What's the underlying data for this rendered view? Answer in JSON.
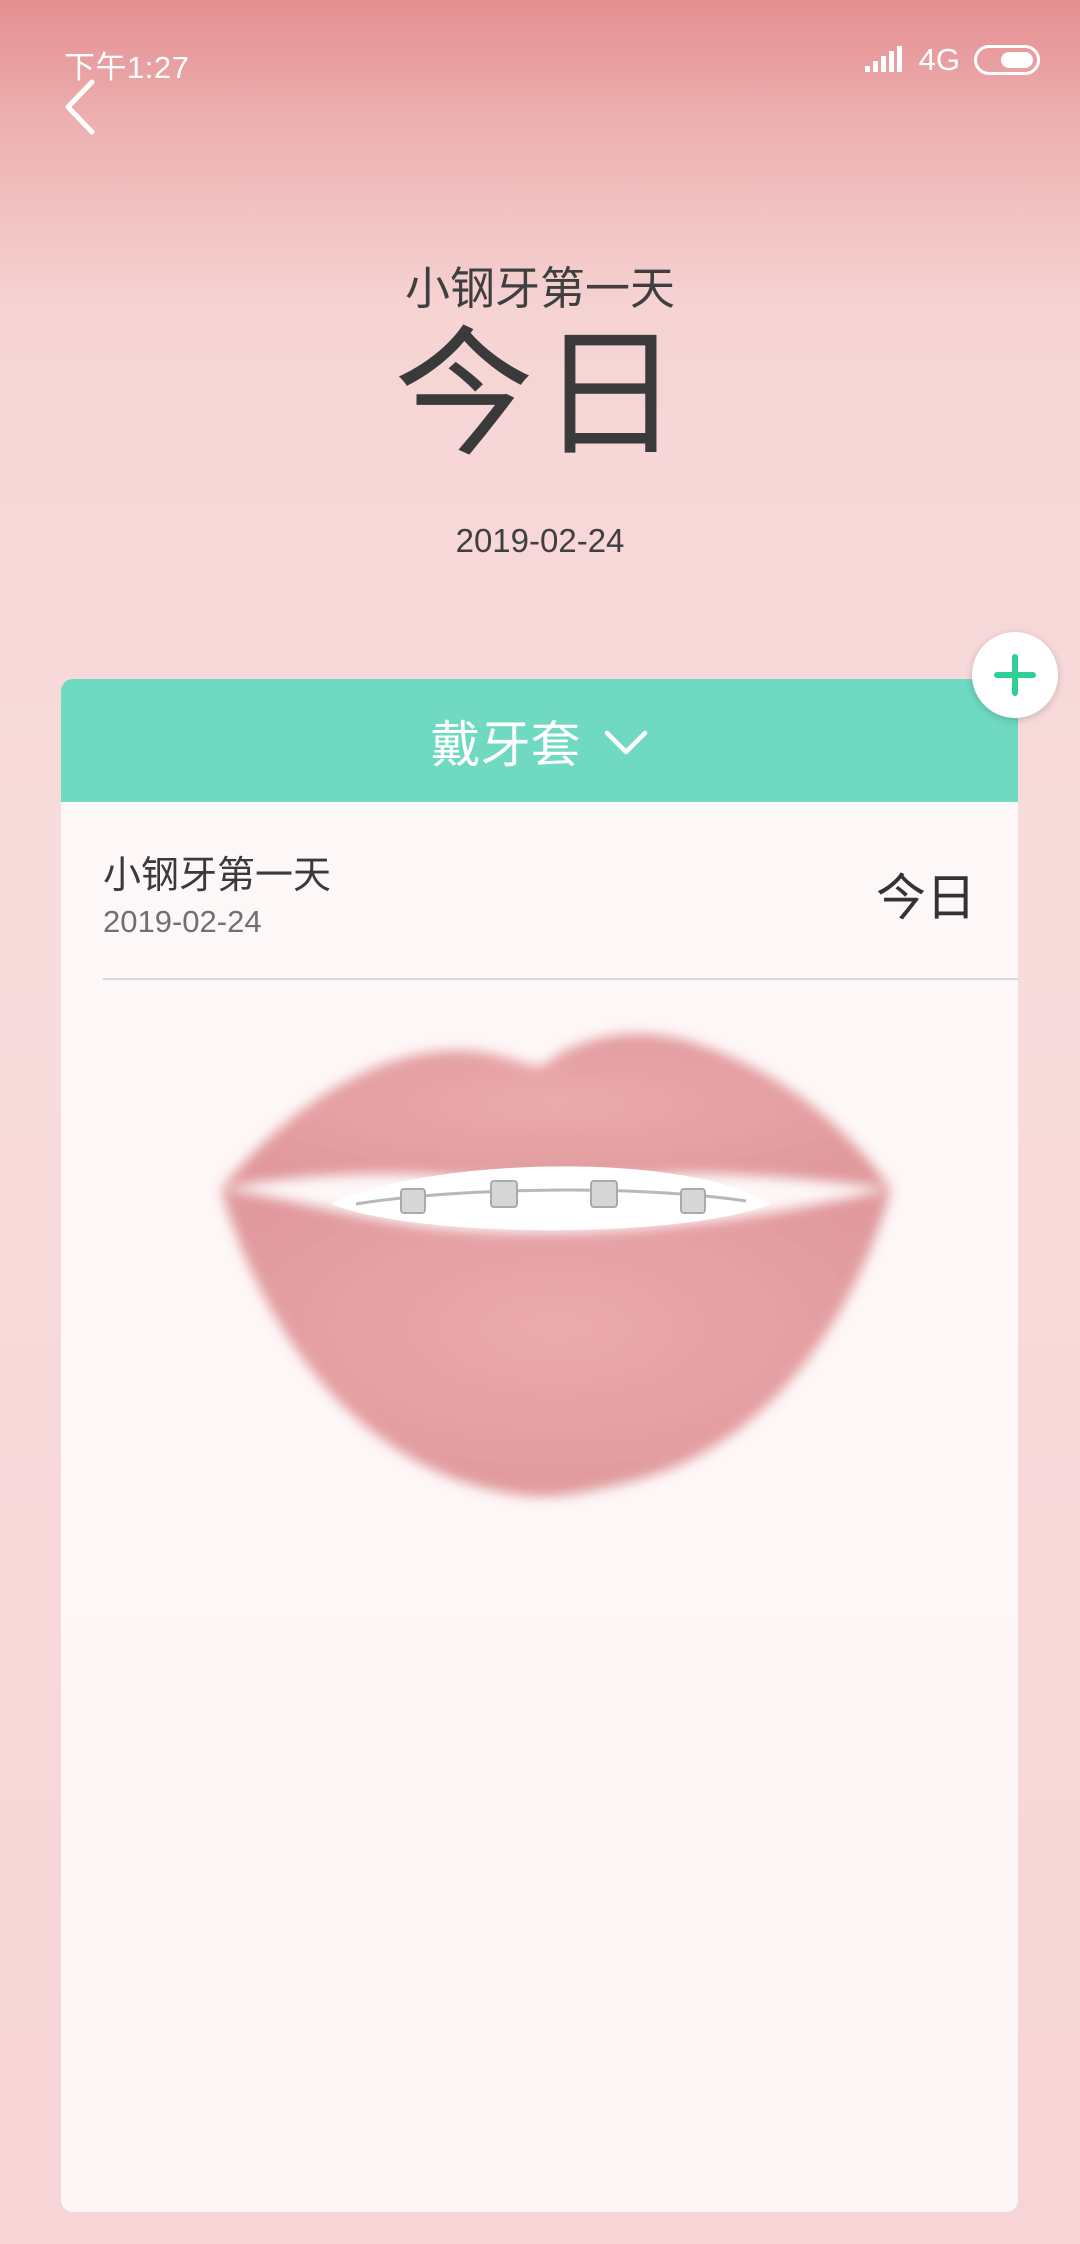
{
  "status_bar": {
    "time": "下午1:27",
    "network": "4G"
  },
  "header": {
    "subtitle": "小钢牙第一天",
    "big_label": "今日",
    "date": "2019-02-24"
  },
  "card": {
    "category_label": "戴牙套",
    "items": [
      {
        "title": "小钢牙第一天",
        "date": "2019-02-24",
        "status": "今日"
      }
    ]
  },
  "icons": {
    "back": "chevron-left-icon",
    "dropdown": "chevron-down-icon",
    "add": "plus-icon",
    "signal": "signal-icon",
    "battery": "battery-icon"
  },
  "colors": {
    "accent": "#6fd9c1",
    "add_icon": "#2fcf96",
    "background_top": "#e48e91",
    "background": "#f8dcdc",
    "lips": "#d97a80"
  }
}
